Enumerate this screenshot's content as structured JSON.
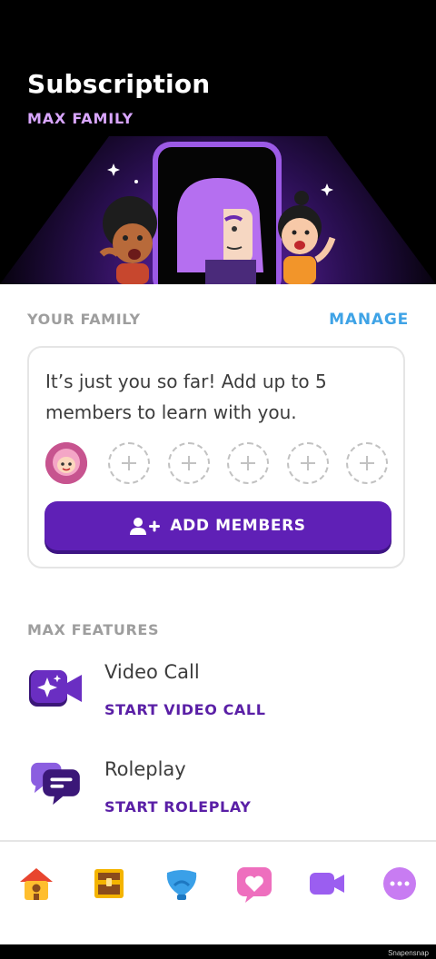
{
  "header": {
    "title": "Subscription",
    "subtitle": "MAX FAMILY"
  },
  "family": {
    "section_label": "YOUR FAMILY",
    "manage_label": "MANAGE",
    "message": "It’s just you so far! Add up to 5 members to learn with you.",
    "add_button_label": "ADD MEMBERS",
    "empty_slots": 5
  },
  "features": {
    "section_label": "MAX FEATURES",
    "items": [
      {
        "title": "Video Call",
        "action": "START VIDEO CALL",
        "icon": "video-sparkle-icon"
      },
      {
        "title": "Roleplay",
        "action": "START ROLEPLAY",
        "icon": "chat-bubbles-icon"
      }
    ]
  },
  "tabs": [
    {
      "name": "home",
      "icon": "home-icon"
    },
    {
      "name": "chest",
      "icon": "treasure-chest-icon"
    },
    {
      "name": "leagues",
      "icon": "shield-icon"
    },
    {
      "name": "hearts",
      "icon": "heart-icon"
    },
    {
      "name": "video",
      "icon": "video-camera-icon"
    },
    {
      "name": "more",
      "icon": "more-icon"
    }
  ],
  "colors": {
    "accent_purple": "#5f20b6",
    "link_blue": "#3fa3e6",
    "max_pink": "#d9a6ff"
  },
  "watermark": "Snapensnap"
}
